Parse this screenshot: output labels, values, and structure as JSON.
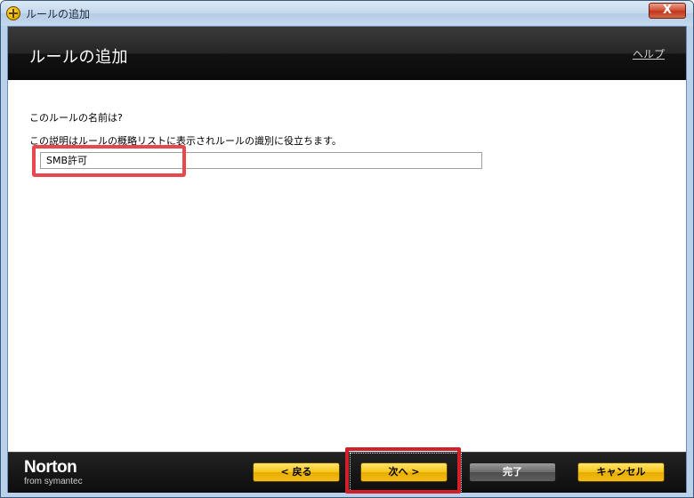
{
  "window": {
    "title": "ルールの追加",
    "close_label": "X"
  },
  "header": {
    "title": "ルールの追加",
    "help_label": "ヘルプ"
  },
  "form": {
    "question": "このルールの名前は?",
    "description": "この説明はルールの概略リストに表示されルールの識別に役立ちます。",
    "name_value": "SMB許可"
  },
  "footer": {
    "logo_main": "Norton",
    "logo_sub": "from symantec",
    "back_label": "< 戻る",
    "next_label": "次へ >",
    "finish_label": "完了",
    "cancel_label": "キャンセル"
  },
  "colors": {
    "highlight": "#e8474b",
    "button_yellow": "#f7c51a",
    "header_dark": "#121212"
  },
  "icons": {
    "app": "norton-globe-icon"
  }
}
